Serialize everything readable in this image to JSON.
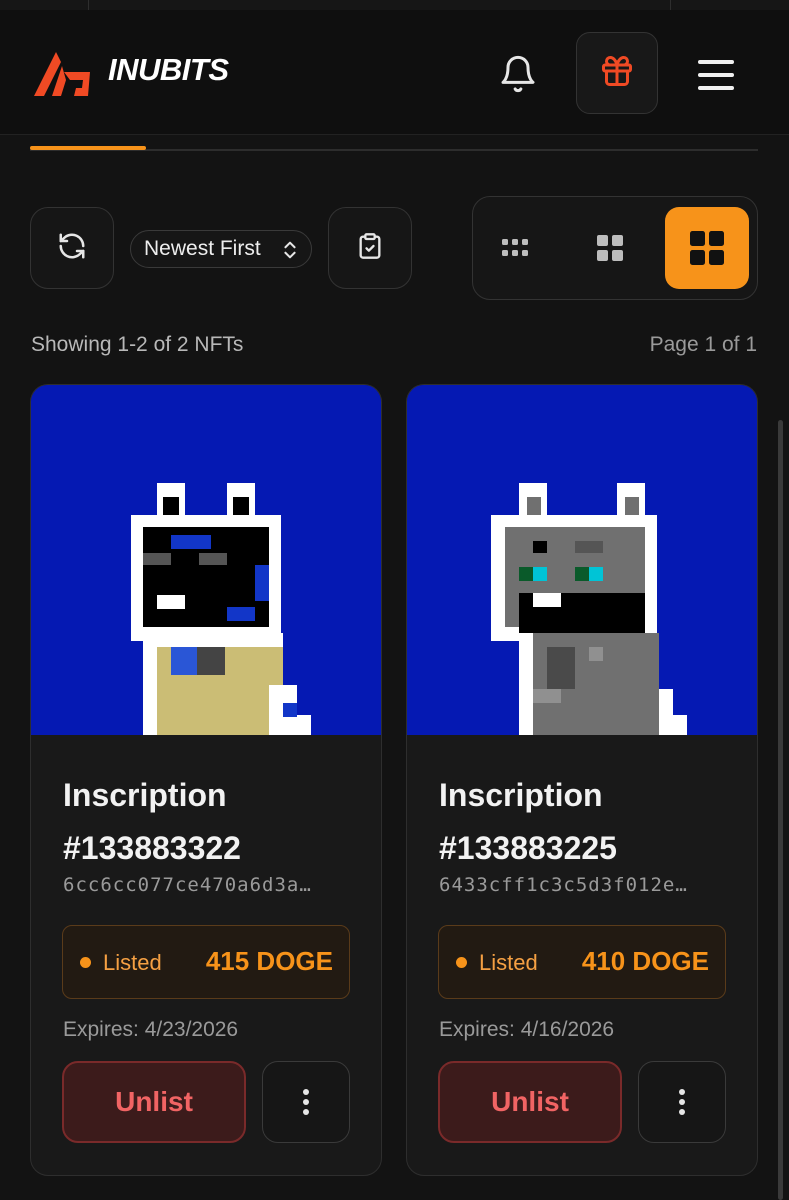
{
  "header": {
    "brand": "INUBITS",
    "icons": {
      "logo": "inubits-logo",
      "notifications": "bell-icon",
      "gift": "gift-icon",
      "menu": "hamburger-menu-icon"
    }
  },
  "toolbar": {
    "refresh_icon": "refresh-icon",
    "sort_label": "Newest First",
    "select_icon": "clipboard-check-icon",
    "views": [
      {
        "name": "small-grid",
        "active": false
      },
      {
        "name": "medium-grid",
        "active": false
      },
      {
        "name": "large-grid",
        "active": true
      }
    ]
  },
  "results": {
    "showing": "Showing 1-2 of 2 NFTs",
    "page": "Page 1 of 1"
  },
  "cards": [
    {
      "title": "Inscription #133883322",
      "hash": "6cc6cc077ce470a6d3a…",
      "status": "Listed",
      "price": "415 DOGE",
      "expires": "Expires: 4/23/2026",
      "unlist_label": "Unlist"
    },
    {
      "title": "Inscription #133883225",
      "hash": "6433cff1c3c5d3f012e…",
      "status": "Listed",
      "price": "410 DOGE",
      "expires": "Expires: 4/16/2026",
      "unlist_label": "Unlist"
    }
  ],
  "colors": {
    "accent": "#f7931a",
    "background": "#131313",
    "card_bg": "#191919",
    "image_bg": "#0519b3",
    "danger": "#f16464",
    "danger_bg": "#3c1b1b"
  }
}
